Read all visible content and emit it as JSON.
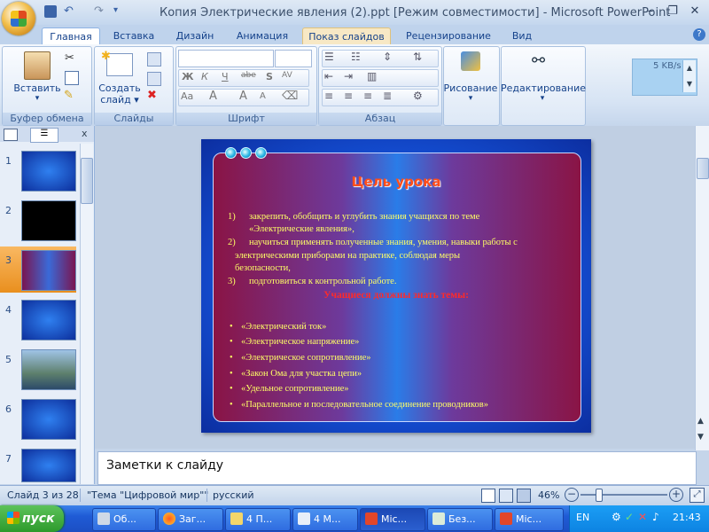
{
  "window": {
    "title": "Копия Электрические явления (2).ppt [Режим совместимости] - Microsoft PowerPoint",
    "minimize": "–",
    "restore": "❐",
    "close": "✕"
  },
  "tabs": [
    "Главная",
    "Вставка",
    "Дизайн",
    "Анимация",
    "Показ слайдов",
    "Рецензирование",
    "Вид"
  ],
  "help_label": "?",
  "ribbon": {
    "clipboard": {
      "paste": "Вставить",
      "label": "Буфер обмена"
    },
    "slides": {
      "create_line1": "Создать",
      "create_line2": "слайд ▾",
      "label": "Слайды"
    },
    "font": {
      "label": "Шрифт",
      "bold": "Ж",
      "italic": "К",
      "underline": "Ч",
      "strike": "abe",
      "shadow": "S",
      "spacing": "AV",
      "case": "Aa",
      "grow": "A",
      "shrink": "A"
    },
    "paragraph": {
      "label": "Абзац"
    },
    "drawing": {
      "label": "Рисование"
    },
    "editing": {
      "label": "Редактирование"
    },
    "speed": "5 KB/s"
  },
  "pane": {
    "thumb_numbers": [
      "1",
      "2",
      "3",
      "4",
      "5",
      "6",
      "7"
    ],
    "close": "x"
  },
  "slide": {
    "title": "Цель урока",
    "items": [
      {
        "num": "1)",
        "line1": "закрепить, обобщить и углубить знания учащихся по теме",
        "line2": "«Электрические явления»,"
      },
      {
        "num": "2)",
        "line1": "научиться применять полученные знания, умения, навыки работы с",
        "line2": "электрическими приборами на практике, соблюдая меры",
        "line3": "безопасности,"
      },
      {
        "num": "3)",
        "line1": "подготовиться к контрольной работе."
      }
    ],
    "subtitle": "Учащиеся должны знать темы:",
    "bullets": [
      "«Электрический ток»",
      "«Электрическое напряжение»",
      "«Электрическое сопротивление»",
      "«Закон Ома для участка цепи»",
      "«Удельное сопротивление»",
      "«Параллельное и последовательное соединение проводников»"
    ]
  },
  "notes": "Заметки к слайду",
  "status": {
    "slide": "Слайд 3 из 28",
    "theme": "\"Тема \"Цифровой мир\"\"",
    "language": "русский",
    "zoom": "46%",
    "minus": "−",
    "plus": "+"
  },
  "taskbar": {
    "start": "пуск",
    "items": [
      "Об...",
      "Заг...",
      "4 П...",
      "4 М...",
      "Mic...",
      "Без...",
      "Mic..."
    ],
    "lang": "EN",
    "time": "21:43"
  },
  "colors": {
    "title_text": "#ff4d1a",
    "slide_text": "#ffff66",
    "subtitle_text": "#ff2a2a"
  }
}
